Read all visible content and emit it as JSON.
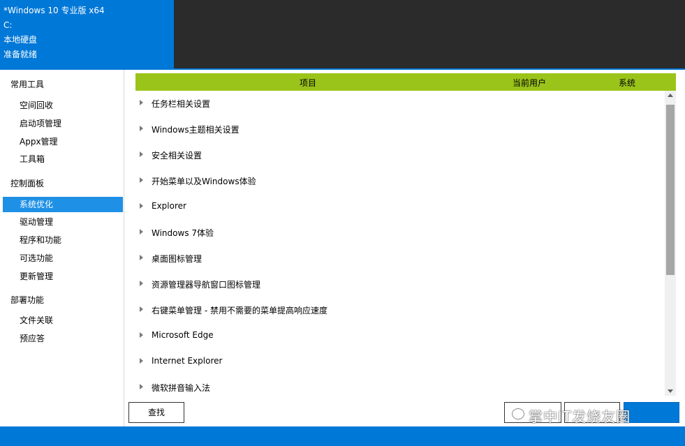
{
  "info": {
    "os": "*Windows 10 专业版 x64",
    "drive": "C:",
    "disk": "本地硬盘",
    "status": "准备就绪"
  },
  "sidebar": {
    "groups": [
      {
        "title": "常用工具",
        "items": [
          "空间回收",
          "启动项管理",
          "Appx管理",
          "工具箱"
        ]
      },
      {
        "title": "控制面板",
        "items": [
          "系统优化",
          "驱动管理",
          "程序和功能",
          "可选功能",
          "更新管理"
        ]
      },
      {
        "title": "部署功能",
        "items": [
          "文件关联",
          "预应答"
        ]
      }
    ],
    "selected": "系统优化"
  },
  "table": {
    "headers": {
      "item": "项目",
      "user": "当前用户",
      "system": "系统"
    },
    "rows": [
      "任务栏相关设置",
      "Windows主题相关设置",
      "安全相关设置",
      "开始菜单以及Windows体验",
      "Explorer",
      "Windows 7体验",
      "桌面图标管理",
      "资源管理器导航窗口图标管理",
      "右键菜单管理 - 禁用不需要的菜单提高响应速度",
      "Microsoft Edge",
      "Internet Explorer",
      "微软拼音输入法"
    ]
  },
  "buttons": {
    "find": "查找",
    "a": "",
    "b": ""
  },
  "watermark": "掌中IT发烧友圈",
  "colors": {
    "accent": "#0078d7",
    "header_green": "#9ac41a",
    "selected": "#1e90e6",
    "dark": "#2b2b2b"
  }
}
